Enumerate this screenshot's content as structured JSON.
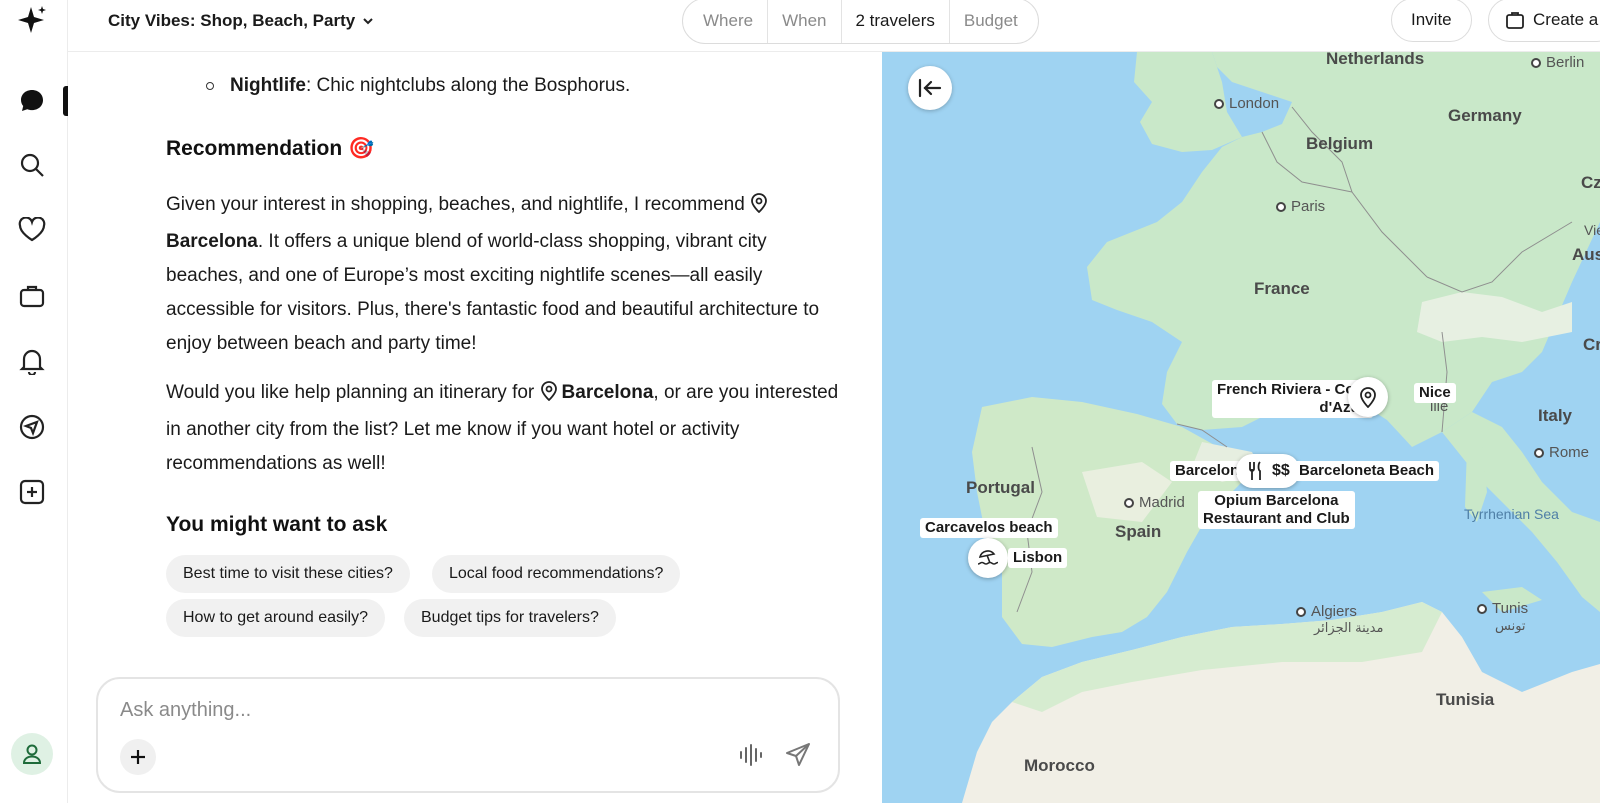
{
  "header": {
    "trip_title": "City Vibes: Shop, Beach, Party",
    "filters": [
      "Where",
      "When",
      "2 travelers",
      "Budget"
    ],
    "invite_label": "Invite",
    "create_label": "Create a"
  },
  "chat": {
    "bullet": {
      "term": "Nightlife",
      "text": ": Chic nightclubs along the Bosphorus."
    },
    "recommendation_heading": "Recommendation",
    "recommendation_emoji": "🎯",
    "para1": {
      "before": "Given your interest in shopping, beaches, and nightlife, I recommend ",
      "place": "Barcelona",
      "after": ". It offers a unique blend of world-class shopping, vibrant city beaches, and one of Europe’s most exciting nightlife scenes—all easily accessible for visitors. Plus, there's fantastic food and beautiful architecture to enjoy between beach and party time!"
    },
    "para2": {
      "before": "Would you like help planning an itinerary for ",
      "place": "Barcelona",
      "after": ", or are you interested in another city from the list? Let me know if you want hotel or activity recommendations as well!"
    },
    "ask_heading": "You might want to ask",
    "suggestions": [
      "Best time to visit these cities?",
      "Local food recommendations?",
      "How to get around easily?",
      "Budget tips for travelers?"
    ],
    "composer_placeholder": "Ask anything..."
  },
  "map": {
    "countries": [
      "Netherlands",
      "Germany",
      "Belgium",
      "France",
      "Portugal",
      "Spain",
      "Italy",
      "Tunisia",
      "Morocco",
      "Cz",
      "Austri",
      "Croa"
    ],
    "cities": [
      "Berlin",
      "London",
      "Paris",
      "Madrid",
      "Rome",
      "Algiers",
      "Tunis"
    ],
    "city_native": {
      "algiers": "مدينة الجزائر",
      "tunis": "تونس"
    },
    "partial": {
      "vie": "Vie",
      "marseille_tail": "ille"
    },
    "sea": "Tyrrhenian Sea",
    "pois": {
      "riviera_line1": "French Riviera - Cote",
      "riviera_line2": "d'Azur",
      "nice": "Nice",
      "barcelona": "Barcelona",
      "barceloneta": "Barceloneta Beach",
      "opium_line1": "Opium Barcelona",
      "opium_line2": "Restaurant and Club",
      "carcavelos": "Carcavelos beach",
      "lisbon": "Lisbon",
      "price": "$$"
    }
  }
}
